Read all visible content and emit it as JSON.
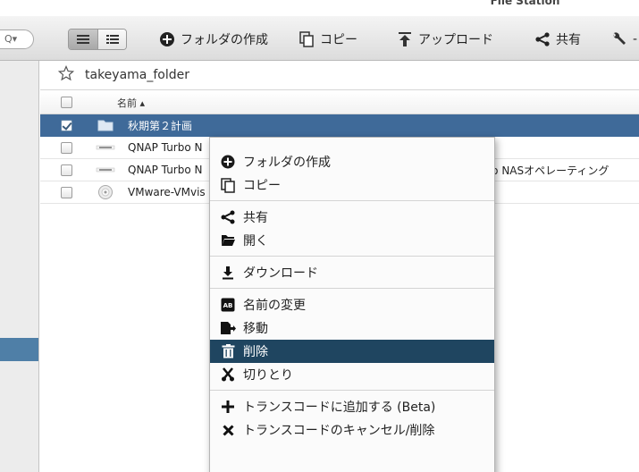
{
  "app": {
    "title": "File Station"
  },
  "toolbar": {
    "search_prefix": "Q▾",
    "create_folder": "フォルダの作成",
    "copy": "コピー",
    "upload": "アップロード",
    "share": "共有",
    "more": "-"
  },
  "breadcrumb": {
    "folder": "takeyama_folder"
  },
  "table": {
    "name_header": "名前 ▴",
    "rows": [
      {
        "name": "秋期第２計画",
        "extra": "",
        "checked": true,
        "icon": "folder-icon"
      },
      {
        "name": "QNAP Turbo N",
        "extra": "",
        "checked": false,
        "icon": "qnap-file-icon"
      },
      {
        "name": "QNAP Turbo N",
        "extra": "urbo NASオペレーティング",
        "checked": false,
        "icon": "qnap-file-icon"
      },
      {
        "name": "VMware-VMvis",
        "extra": "",
        "checked": false,
        "icon": "disc-icon"
      }
    ]
  },
  "context_menu": {
    "create_folder": "フォルダの作成",
    "copy": "コピー",
    "share": "共有",
    "open": "開く",
    "download": "ダウンロード",
    "rename": "名前の変更",
    "move": "移動",
    "delete": "削除",
    "cut": "切りとり",
    "add_transcode": "トランスコードに追加する (Beta)",
    "cancel_transcode": "トランスコードのキャンセル/削除"
  },
  "colors": {
    "selection": "#3f6a99",
    "menu_highlight": "#1f4560",
    "sidebar_highlight": "#4f7fa7"
  }
}
